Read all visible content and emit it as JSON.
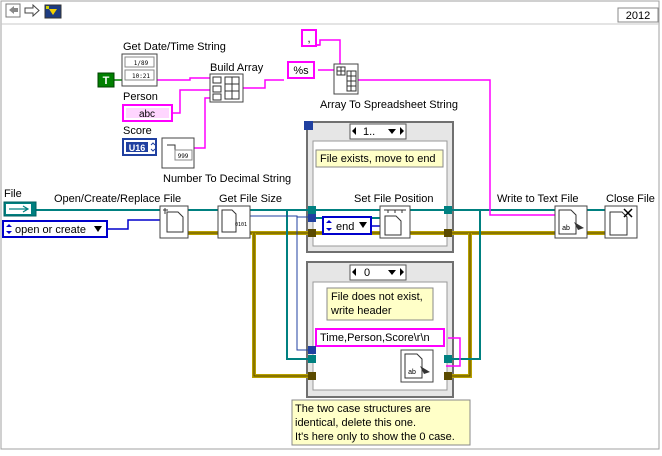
{
  "toolbar": {
    "icons": [
      "run-arrow-icon",
      "forward-arrow-icon",
      "labview-vi-icon"
    ],
    "version": "2012"
  },
  "nodes": {
    "get_date_time": "Get Date/Time String",
    "build_array": "Build Array",
    "array_to_spreadsheet": "Array To Spreadsheet String",
    "number_to_decimal": "Number To Decimal String",
    "open_create_replace": "Open/Create/Replace File",
    "get_file_size": "Get File Size",
    "set_file_position": "Set File Position",
    "write_to_text_file": "Write to Text File",
    "close_file": "Close File"
  },
  "controls": {
    "file_label": "File",
    "person_label": "Person",
    "score_label": "Score",
    "true_const": "T",
    "person_type": "abc",
    "score_type": "U16",
    "open_or_create": "open or create",
    "end_enum": "end",
    "format_const": "%s",
    "delimiter_const": ",",
    "header_string": "Time,Person,Score\\r\\n"
  },
  "case_structures": {
    "top_selector": "1..",
    "top_comment": "File exists, move to end",
    "bottom_selector": "0",
    "bottom_comment_line1": "File does not exist,",
    "bottom_comment_line2": "write header"
  },
  "note": {
    "line1": "The two case structures are",
    "line2": "identical, delete this one.",
    "line3": "It's here only to show the 0 case."
  },
  "colors": {
    "string_wire": "#ff00ff",
    "refnum_wire": "#008080",
    "error_wire": "#b8a000",
    "enum_wire": "#0000cc",
    "boolean_wire": "#008000",
    "comment_bg": "#ffffc8",
    "structure_border": "#707070"
  }
}
